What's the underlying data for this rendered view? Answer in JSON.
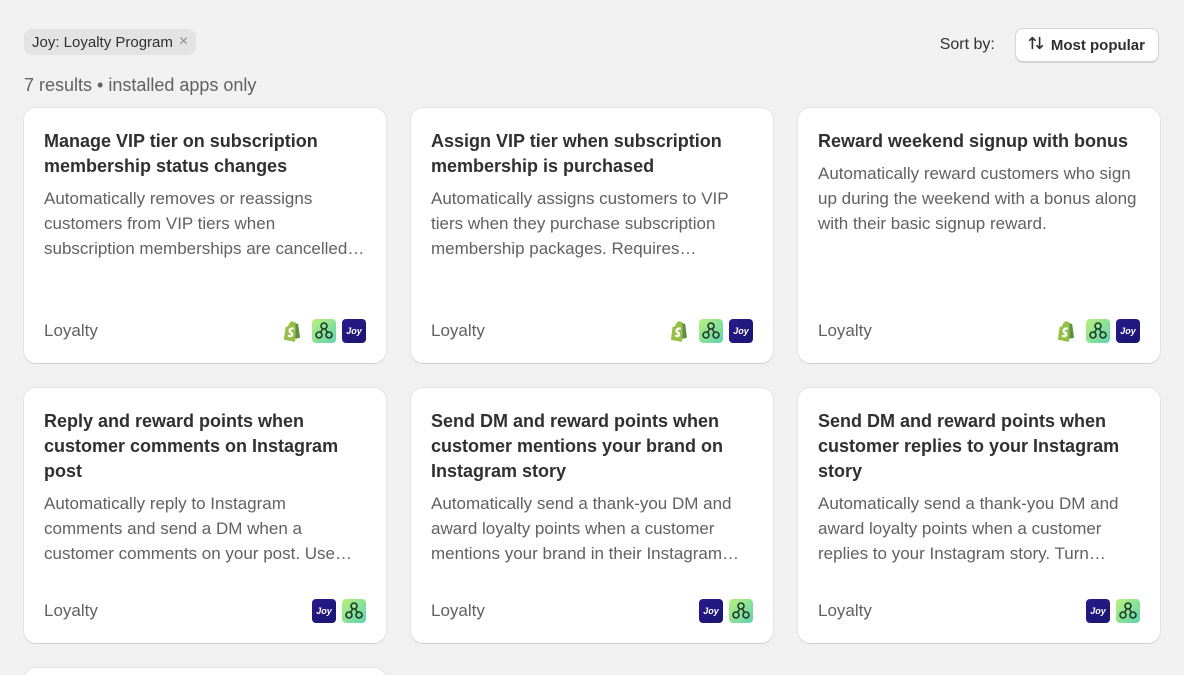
{
  "filter": {
    "label": "Joy: Loyalty Program",
    "close_glyph": "×"
  },
  "sort": {
    "label": "Sort by:",
    "value": "Most popular"
  },
  "results_text": "7 results • installed apps only",
  "colors": {
    "background": "#f1f1f1",
    "card": "#ffffff",
    "shopify_green": "#95bf47",
    "joy_purple": "#2a1a8c"
  },
  "cards": [
    {
      "title": "Manage VIP tier on subscription membership status changes",
      "description": "Automatically removes or reassigns customers from VIP tiers when subscription memberships are cancelled or paused.",
      "category": "Loyalty",
      "icons": [
        "shopify-icon",
        "flow-icon",
        "joy-icon"
      ]
    },
    {
      "title": "Assign VIP tier when subscription membership is purchased",
      "description": "Automatically assigns customers to VIP tiers when they purchase subscription membership packages. Requires subscription setup.",
      "category": "Loyalty",
      "icons": [
        "shopify-icon",
        "flow-icon",
        "joy-icon"
      ]
    },
    {
      "title": "Reward weekend signup with bonus",
      "description": "Automatically reward customers who sign up during the weekend with a bonus along with their basic signup reward.",
      "category": "Loyalty",
      "icons": [
        "shopify-icon",
        "flow-icon",
        "joy-icon"
      ]
    },
    {
      "title": "Reply and reward points when customer comments on Instagram post",
      "description": "Automatically reply to Instagram comments and send a DM when a customer comments on your post. Use this to reward engagement.",
      "category": "Loyalty",
      "icons": [
        "joy-icon",
        "flow-icon"
      ]
    },
    {
      "title": "Send DM and reward points when customer mentions your brand on Instagram story",
      "description": "Automatically send a thank-you DM and award loyalty points when a customer mentions your brand in their Instagram story.",
      "category": "Loyalty",
      "icons": [
        "joy-icon",
        "flow-icon"
      ]
    },
    {
      "title": "Send DM and reward points when customer replies to your Instagram story",
      "description": "Automatically send a thank-you DM and award loyalty points when a customer replies to your Instagram story. Turn replies into rewards.",
      "category": "Loyalty",
      "icons": [
        "joy-icon",
        "flow-icon"
      ]
    }
  ],
  "joy_icon_text": "Joy"
}
